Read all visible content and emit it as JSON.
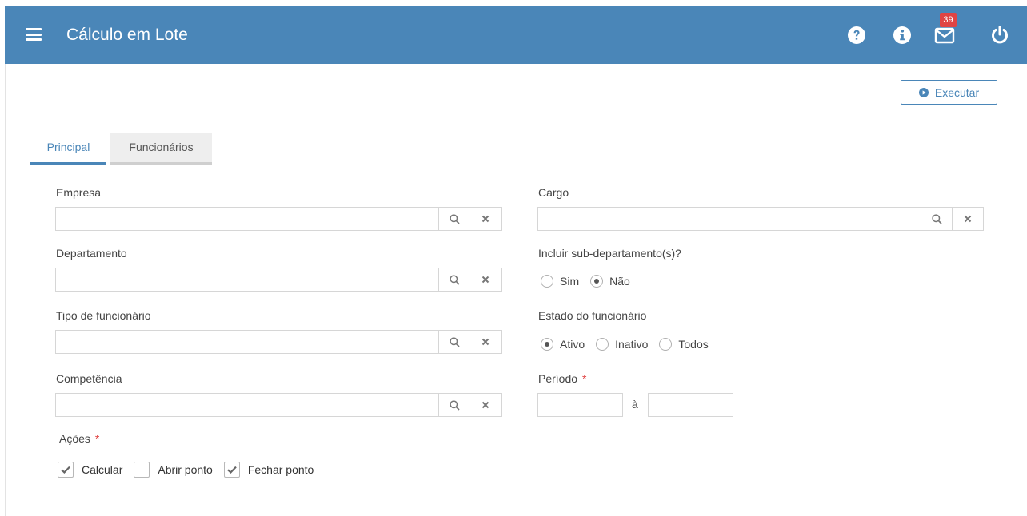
{
  "header": {
    "title": "Cálculo em Lote",
    "icons": [
      "menu-icon",
      "help-icon",
      "info-icon",
      "mail-icon",
      "power-icon"
    ],
    "mail_badge": "39",
    "color": "#4a86b8"
  },
  "toolbar": {
    "execute_label": "Executar"
  },
  "tabs": [
    {
      "label": "Principal",
      "active": true
    },
    {
      "label": "Funcionários",
      "active": false
    }
  ],
  "form": {
    "empresa": {
      "label": "Empresa",
      "value": ""
    },
    "departamento": {
      "label": "Departamento",
      "value": ""
    },
    "tipo_funcionario": {
      "label": "Tipo de funcionário",
      "value": ""
    },
    "competencia": {
      "label": "Competência",
      "value": ""
    },
    "cargo": {
      "label": "Cargo",
      "value": ""
    },
    "incluir_sub": {
      "label": "Incluir sub-departamento(s)?",
      "options": [
        "Sim",
        "Não"
      ],
      "selected": "Não"
    },
    "estado": {
      "label": "Estado do funcionário",
      "options": [
        "Ativo",
        "Inativo",
        "Todos"
      ],
      "selected": "Ativo"
    },
    "periodo": {
      "label": "Período",
      "required_mark": "*",
      "separator": "à",
      "start": "",
      "end": ""
    },
    "acoes": {
      "label": "Ações",
      "required_mark": "*",
      "options": [
        {
          "label": "Calcular",
          "checked": true
        },
        {
          "label": "Abrir ponto",
          "checked": false
        },
        {
          "label": "Fechar ponto",
          "checked": true
        }
      ]
    }
  }
}
